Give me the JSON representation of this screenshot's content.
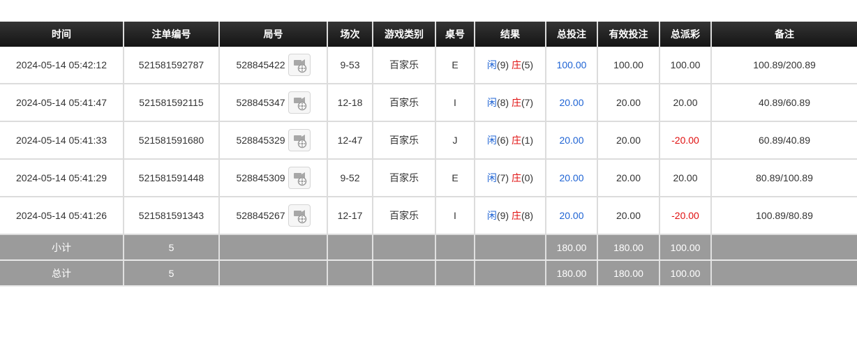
{
  "columns": [
    "时间",
    "注单编号",
    "局号",
    "场次",
    "游戏类别",
    "桌号",
    "结果",
    "总投注",
    "有效投注",
    "总派彩",
    "备注"
  ],
  "rows": [
    {
      "time": "2024-05-14 05:42:12",
      "bet_id": "521581592787",
      "round": "528845422",
      "session": "9-53",
      "game": "百家乐",
      "table": "E",
      "player_label": "闲",
      "player_val": "(9)",
      "banker_label": "庄",
      "banker_val": "(5)",
      "total_bet": "100.00",
      "valid_bet": "100.00",
      "payout": "100.00",
      "payout_negative": false,
      "note": "100.89/200.89"
    },
    {
      "time": "2024-05-14 05:41:47",
      "bet_id": "521581592115",
      "round": "528845347",
      "session": "12-18",
      "game": "百家乐",
      "table": "I",
      "player_label": "闲",
      "player_val": "(8)",
      "banker_label": "庄",
      "banker_val": "(7)",
      "total_bet": "20.00",
      "valid_bet": "20.00",
      "payout": "20.00",
      "payout_negative": false,
      "note": "40.89/60.89"
    },
    {
      "time": "2024-05-14 05:41:33",
      "bet_id": "521581591680",
      "round": "528845329",
      "session": "12-47",
      "game": "百家乐",
      "table": "J",
      "player_label": "闲",
      "player_val": "(6)",
      "banker_label": "庄",
      "banker_val": "(1)",
      "total_bet": "20.00",
      "valid_bet": "20.00",
      "payout": "-20.00",
      "payout_negative": true,
      "note": "60.89/40.89"
    },
    {
      "time": "2024-05-14 05:41:29",
      "bet_id": "521581591448",
      "round": "528845309",
      "session": "9-52",
      "game": "百家乐",
      "table": "E",
      "player_label": "闲",
      "player_val": "(7)",
      "banker_label": "庄",
      "banker_val": "(0)",
      "total_bet": "20.00",
      "valid_bet": "20.00",
      "payout": "20.00",
      "payout_negative": false,
      "note": "80.89/100.89"
    },
    {
      "time": "2024-05-14 05:41:26",
      "bet_id": "521581591343",
      "round": "528845267",
      "session": "12-17",
      "game": "百家乐",
      "table": "I",
      "player_label": "闲",
      "player_val": "(9)",
      "banker_label": "庄",
      "banker_val": "(8)",
      "total_bet": "20.00",
      "valid_bet": "20.00",
      "payout": "-20.00",
      "payout_negative": true,
      "note": "100.89/80.89"
    }
  ],
  "subtotal": {
    "label": "小计",
    "count": "5",
    "total_bet": "180.00",
    "valid_bet": "180.00",
    "payout": "100.00"
  },
  "total": {
    "label": "总计",
    "count": "5",
    "total_bet": "180.00",
    "valid_bet": "180.00",
    "payout": "100.00"
  },
  "icons": {
    "replay": "video-replay-icon"
  },
  "colors": {
    "header_bg": "#1a1a1a",
    "summary_bg": "#9b9b9b",
    "blue": "#1e63d4",
    "red": "#e01010"
  }
}
